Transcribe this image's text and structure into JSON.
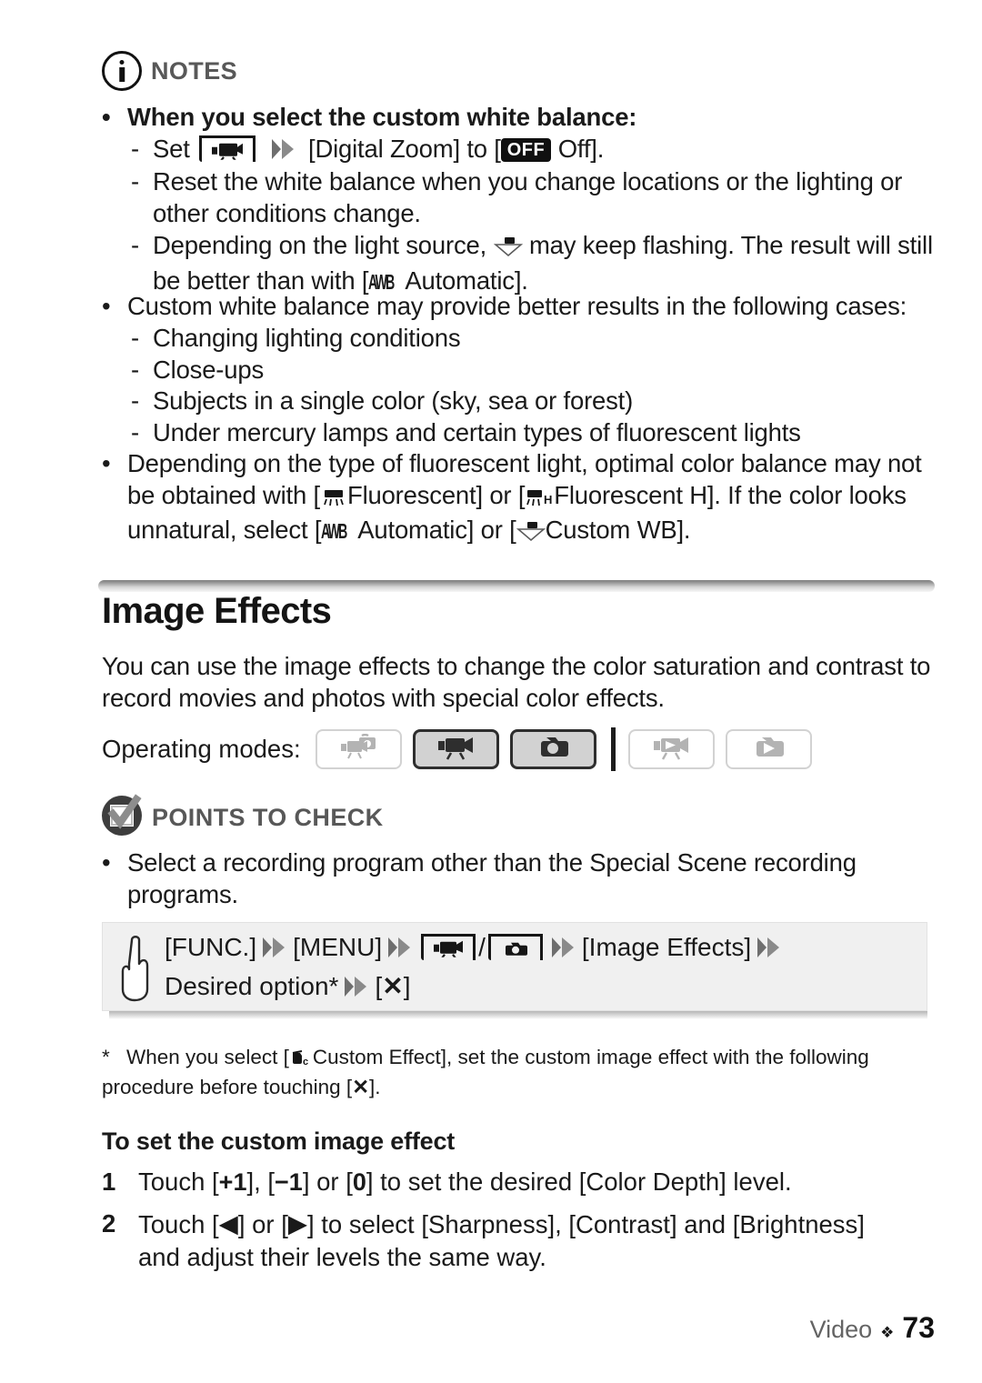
{
  "notes": {
    "icon": "info-circle-icon",
    "label": "NOTES",
    "items": [
      {
        "bullet": "•",
        "text": "When you select the custom white balance:",
        "bold": true
      },
      {
        "dash": "-",
        "pre": "Set",
        "icon1": "video-mode-icon",
        "arrow": "double-chevron-right-icon",
        "mid": "[Digital Zoom] to [",
        "pill": "OFF",
        "post": "Off]."
      },
      {
        "dash": "-",
        "text": "Reset the white balance when you change locations or the lighting or other conditions change."
      },
      {
        "dash": "-",
        "pre": "Depending on the light source,",
        "icon": "custom-white-balance-icon",
        "mid": "may keep flashing. The result will still be better than with [",
        "glyph": "AWB",
        "post": "Automatic]."
      },
      {
        "bullet": "•",
        "text": "Custom white balance may provide better results in the following cases:"
      },
      {
        "dash": "-",
        "text": "Changing lighting conditions"
      },
      {
        "dash": "-",
        "text": "Close-ups"
      },
      {
        "dash": "-",
        "text": "Subjects in a single color (sky, sea or forest)"
      },
      {
        "dash": "-",
        "text": "Under mercury lamps and certain types of fluorescent lights"
      },
      {
        "bullet": "•",
        "seg1": "Depending on the type of fluorescent light, optimal color balance may not be obtained with [",
        "icon1": "fluorescent-icon",
        "seg2": "Fluorescent] or [",
        "icon2": "fluorescent-h-icon",
        "seg3": "Fluorescent H]. If the color looks unnatural, select [",
        "glyph": "AWB",
        "seg4": "Automatic] or [",
        "icon3": "custom-white-balance-icon",
        "seg5": "Custom WB]."
      }
    ]
  },
  "section": {
    "title": "Image Effects",
    "intro": "You can use the image effects to change the color saturation and contrast to record movies and photos with special color effects."
  },
  "operating_modes": {
    "label": "Operating modes:",
    "buttons": [
      {
        "name": "auto-dual-shot-mode",
        "icon": "auto-camcorder-icon",
        "state": "inactive"
      },
      {
        "name": "video-record-mode",
        "icon": "camcorder-icon",
        "state": "active"
      },
      {
        "name": "photo-record-mode",
        "icon": "still-camera-icon",
        "state": "active"
      },
      {
        "name": "video-playback-mode",
        "icon": "camcorder-play-icon",
        "state": "inactive"
      },
      {
        "name": "photo-playback-mode",
        "icon": "camera-play-icon",
        "state": "inactive"
      }
    ],
    "divider_after_index": 2
  },
  "points_to_check": {
    "icon": "checkbox-check-icon",
    "label": "POINTS TO CHECK",
    "items": [
      {
        "bullet": "•",
        "text": "Select a recording program other than the Special Scene recording programs."
      }
    ]
  },
  "procedure": {
    "hand_icon": "pointing-hand-icon",
    "line1": {
      "func": "[FUNC.]",
      "menu": "[MENU]",
      "slash": "/",
      "target": "[Image Effects]",
      "arrow": "double-chevron-right-icon",
      "icon_video": "video-mode-icon",
      "icon_photo": "photo-mode-icon"
    },
    "line2": {
      "option": "Desired option*",
      "arrow": "double-chevron-right-icon",
      "close_open": "[",
      "close_icon": "✕",
      "close_close": "]"
    }
  },
  "footnote": {
    "star": "*",
    "seg1": "When you select [",
    "icon": "custom-effect-icon",
    "seg2": "Custom Effect], set the custom image effect with the following procedure before touching [",
    "close_icon": "✕",
    "seg3": "]."
  },
  "custom_effect": {
    "subhead": "To set the custom image effect",
    "steps": [
      {
        "num": "1",
        "seg1": "Touch [",
        "key1": "+1",
        "seg2": "], [",
        "key2": "−1",
        "seg3": "] or [",
        "key3": "0",
        "seg4": "] to set the desired [Color Depth] level."
      },
      {
        "num": "2",
        "seg1": "Touch [",
        "key1": "◀",
        "seg2": "] or [",
        "key2": "▶",
        "seg3": "] to select [Sharpness], [Contrast] and [Brightness] and adjust their levels the same way."
      }
    ]
  },
  "footer": {
    "label": "Video",
    "diamond": "❖",
    "page": "73"
  }
}
